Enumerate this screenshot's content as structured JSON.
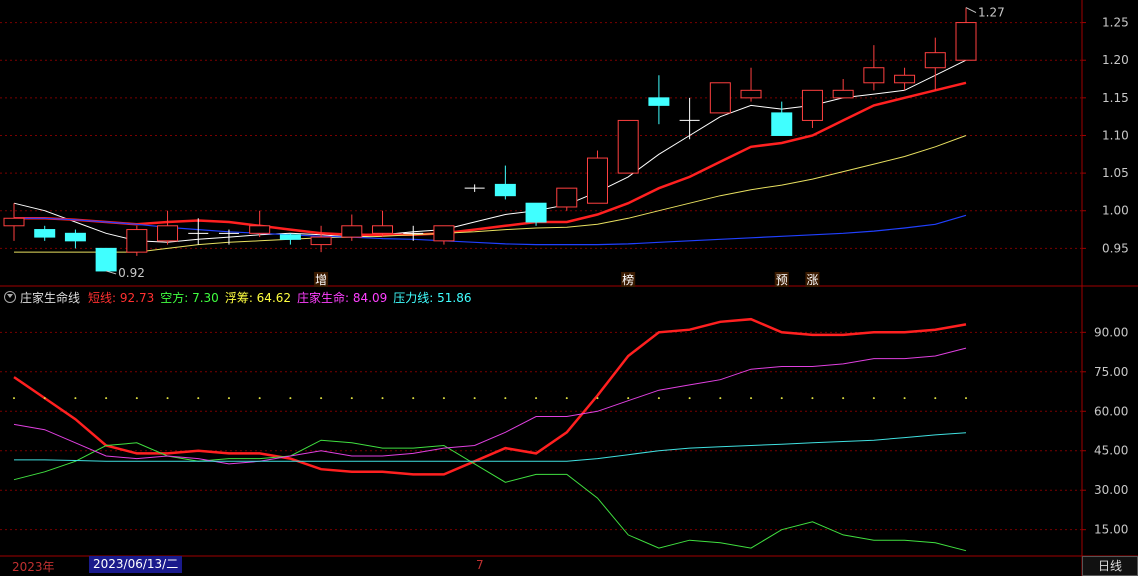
{
  "colors": {
    "up": "#ff4040",
    "down": "#40ffff",
    "ma5": "#ffffff",
    "ma10": "#ff2020",
    "ma20": "#e8e060",
    "ma60": "#2040ff",
    "grid": "#7a0000",
    "axis": "#a00000",
    "label": "#c8c8c8"
  },
  "price_panel": {
    "y_ticks": [
      "1.25",
      "1.20",
      "1.15",
      "1.10",
      "1.05",
      "1.00",
      "0.95"
    ],
    "max_label": "1.27",
    "min_label": "0.92",
    "markers": [
      {
        "text": "增",
        "index": 10
      },
      {
        "text": "榜",
        "index": 20
      },
      {
        "text": "预",
        "index": 25
      },
      {
        "text": "涨",
        "index": 26
      }
    ]
  },
  "indicator": {
    "name": "庄家生命线",
    "items": [
      {
        "label": "短线: 92.73",
        "color": "#ff3030"
      },
      {
        "label": "空方: 7.30",
        "color": "#40ff40"
      },
      {
        "label": "浮筹: 64.62",
        "color": "#ffff40"
      },
      {
        "label": "庄家生命: 84.09",
        "color": "#ff40ff"
      },
      {
        "label": "压力线: 51.86",
        "color": "#40ffff"
      }
    ],
    "y_ticks": [
      "90.00",
      "75.00",
      "60.00",
      "45.00",
      "30.00",
      "15.00"
    ]
  },
  "footer": {
    "year": "2023年",
    "date": "2023/06/13/二",
    "month": "7",
    "period": "日线"
  },
  "chart_data": [
    {
      "type": "candlestick",
      "ylim": [
        0.9,
        1.28
      ],
      "candles": [
        {
          "o": 0.98,
          "c": 0.99,
          "h": 1.01,
          "l": 0.96
        },
        {
          "o": 0.975,
          "c": 0.965,
          "h": 0.98,
          "l": 0.96
        },
        {
          "o": 0.97,
          "c": 0.96,
          "h": 0.975,
          "l": 0.95
        },
        {
          "o": 0.95,
          "c": 0.92,
          "h": 0.95,
          "l": 0.92
        },
        {
          "o": 0.945,
          "c": 0.975,
          "h": 0.98,
          "l": 0.94
        },
        {
          "o": 0.96,
          "c": 0.98,
          "h": 1.0,
          "l": 0.955
        },
        {
          "o": 0.97,
          "c": 0.97,
          "h": 0.99,
          "l": 0.955
        },
        {
          "o": 0.97,
          "c": 0.97,
          "h": 0.975,
          "l": 0.955
        },
        {
          "o": 0.97,
          "c": 0.98,
          "h": 1.0,
          "l": 0.965
        },
        {
          "o": 0.968,
          "c": 0.962,
          "h": 0.97,
          "l": 0.955
        },
        {
          "o": 0.955,
          "c": 0.965,
          "h": 0.98,
          "l": 0.945
        },
        {
          "o": 0.965,
          "c": 0.98,
          "h": 0.995,
          "l": 0.96
        },
        {
          "o": 0.97,
          "c": 0.98,
          "h": 1.0,
          "l": 0.965
        },
        {
          "o": 0.97,
          "c": 0.97,
          "h": 0.98,
          "l": 0.96
        },
        {
          "o": 0.96,
          "c": 0.98,
          "h": 0.98,
          "l": 0.955
        },
        {
          "o": 1.03,
          "c": 1.03,
          "h": 1.035,
          "l": 1.025
        },
        {
          "o": 1.035,
          "c": 1.02,
          "h": 1.06,
          "l": 1.015
        },
        {
          "o": 1.01,
          "c": 0.985,
          "h": 1.01,
          "l": 0.98
        },
        {
          "o": 1.005,
          "c": 1.03,
          "h": 1.03,
          "l": 1.0
        },
        {
          "o": 1.01,
          "c": 1.07,
          "h": 1.08,
          "l": 1.01
        },
        {
          "o": 1.05,
          "c": 1.12,
          "h": 1.12,
          "l": 1.05
        },
        {
          "o": 1.15,
          "c": 1.14,
          "h": 1.18,
          "l": 1.115
        },
        {
          "o": 1.12,
          "c": 1.12,
          "h": 1.15,
          "l": 1.095
        },
        {
          "o": 1.13,
          "c": 1.17,
          "h": 1.17,
          "l": 1.13
        },
        {
          "o": 1.15,
          "c": 1.16,
          "h": 1.19,
          "l": 1.145
        },
        {
          "o": 1.13,
          "c": 1.1,
          "h": 1.145,
          "l": 1.1
        },
        {
          "o": 1.12,
          "c": 1.16,
          "h": 1.16,
          "l": 1.11
        },
        {
          "o": 1.15,
          "c": 1.16,
          "h": 1.175,
          "l": 1.15
        },
        {
          "o": 1.17,
          "c": 1.19,
          "h": 1.22,
          "l": 1.16
        },
        {
          "o": 1.17,
          "c": 1.18,
          "h": 1.19,
          "l": 1.16
        },
        {
          "o": 1.19,
          "c": 1.21,
          "h": 1.23,
          "l": 1.16
        },
        {
          "o": 1.2,
          "c": 1.25,
          "h": 1.27,
          "l": 1.2
        }
      ],
      "series": [
        {
          "key": "ma5",
          "values": [
            1.01,
            1.0,
            0.985,
            0.97,
            0.96,
            0.958,
            0.962,
            0.965,
            0.968,
            0.97,
            0.968,
            0.965,
            0.968,
            0.972,
            0.975,
            0.985,
            0.995,
            1.0,
            1.008,
            1.025,
            1.045,
            1.075,
            1.1,
            1.125,
            1.14,
            1.135,
            1.14,
            1.15,
            1.155,
            1.16,
            1.18,
            1.2
          ]
        },
        {
          "key": "ma10",
          "values": [
            0.99,
            0.99,
            0.988,
            0.985,
            0.982,
            0.985,
            0.987,
            0.985,
            0.98,
            0.975,
            0.97,
            0.968,
            0.968,
            0.968,
            0.97,
            0.975,
            0.98,
            0.985,
            0.985,
            0.995,
            1.01,
            1.03,
            1.045,
            1.065,
            1.085,
            1.09,
            1.1,
            1.12,
            1.14,
            1.15,
            1.16,
            1.17
          ]
        },
        {
          "key": "ma20",
          "values": [
            0.945,
            0.945,
            0.945,
            0.945,
            0.945,
            0.95,
            0.955,
            0.958,
            0.96,
            0.962,
            0.964,
            0.965,
            0.966,
            0.968,
            0.97,
            0.972,
            0.975,
            0.977,
            0.978,
            0.982,
            0.99,
            1.0,
            1.01,
            1.02,
            1.028,
            1.034,
            1.042,
            1.052,
            1.062,
            1.072,
            1.085,
            1.1
          ]
        },
        {
          "key": "ma60",
          "values": [
            0.99,
            0.99,
            0.988,
            0.985,
            0.982,
            0.978,
            0.975,
            0.972,
            0.97,
            0.968,
            0.966,
            0.965,
            0.963,
            0.962,
            0.96,
            0.958,
            0.956,
            0.955,
            0.955,
            0.955,
            0.956,
            0.958,
            0.96,
            0.962,
            0.964,
            0.966,
            0.968,
            0.97,
            0.973,
            0.977,
            0.982,
            0.994
          ]
        }
      ]
    },
    {
      "type": "line",
      "ylim": [
        5,
        100
      ],
      "series": [
        {
          "name": "短线",
          "key": "short",
          "color": "#ff2020",
          "values": [
            73,
            65,
            57,
            47,
            44,
            44,
            45,
            44,
            44,
            42,
            38,
            37,
            37,
            36,
            36,
            41,
            46,
            44,
            52,
            66,
            81,
            90,
            91,
            94,
            95,
            90,
            89,
            89,
            90,
            90,
            91,
            93
          ]
        },
        {
          "name": "空方",
          "key": "bear",
          "color": "#40e040",
          "values": [
            34,
            37,
            41,
            47,
            48,
            43,
            41,
            42,
            42,
            43,
            49,
            48,
            46,
            46,
            47,
            40,
            33,
            36,
            36,
            27,
            13,
            8,
            11,
            10,
            8,
            15,
            18,
            13,
            11,
            11,
            10,
            7
          ]
        },
        {
          "name": "浮筹",
          "key": "float",
          "color": "#e0e040",
          "values": [
            65,
            65,
            65,
            65,
            65,
            65,
            65,
            65,
            65,
            65,
            65,
            65,
            65,
            65,
            65,
            65,
            65,
            65,
            65,
            65,
            65,
            65,
            65,
            65,
            65,
            65,
            65,
            65,
            65,
            65,
            65,
            65
          ]
        },
        {
          "name": "庄家生命",
          "key": "life",
          "color": "#e040e0",
          "values": [
            55,
            53,
            48,
            43,
            42,
            43,
            42,
            40,
            41,
            43,
            45,
            43,
            43,
            44,
            46,
            47,
            52,
            58,
            58,
            60,
            64,
            68,
            70,
            72,
            76,
            77,
            77,
            78,
            80,
            80,
            81,
            84
          ]
        },
        {
          "name": "压力线",
          "key": "press",
          "color": "#40e0e0",
          "values": [
            41.5,
            41.5,
            41.3,
            41,
            41,
            41,
            41,
            41,
            41,
            41,
            41,
            41,
            41,
            41,
            41,
            41,
            41,
            41,
            41,
            42,
            43.5,
            45,
            46,
            46.5,
            47,
            47.5,
            48,
            48.5,
            49,
            50,
            51,
            51.86
          ]
        }
      ]
    }
  ]
}
